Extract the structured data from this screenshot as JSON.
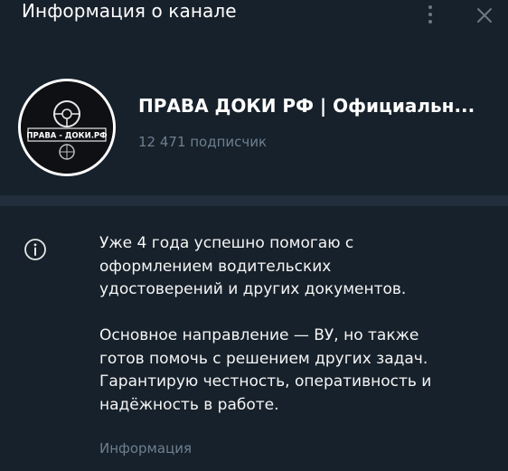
{
  "header": {
    "title": "Информация о канале"
  },
  "profile": {
    "channel_name": "ПРАВА ДОКИ РФ | Официальн...",
    "subscribers": "12 471 подписчик",
    "avatar_text": "ПРАВА - ДОКИ.РФ"
  },
  "info": {
    "description": "Уже 4 года успешно помогаю с\nоформлением водительских\nудостоверений и других документов.\n\nОсновное направление — ВУ, но также\nготов помочь с решением других задач.\nГарантирую честность, оперативность и\nнадёжность в работе.",
    "label": "Информация"
  },
  "icons": {
    "menu": "more-vertical-icon",
    "close": "close-icon",
    "info": "info-icon"
  },
  "colors": {
    "background": "#17212b",
    "divider": "#232e3c",
    "muted_text": "#6d7f8f",
    "icon": "#6c7883"
  }
}
